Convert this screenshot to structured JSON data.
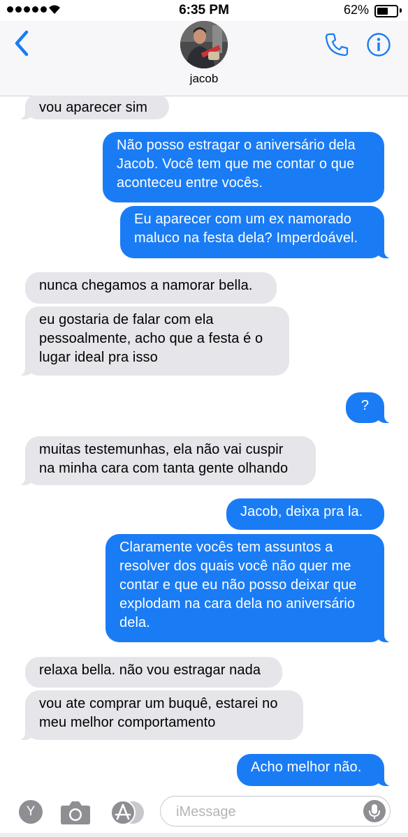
{
  "status_bar": {
    "time": "6:35 PM",
    "battery_percent": "62%",
    "battery_level": 0.62,
    "signal_bars": 5
  },
  "header": {
    "contact_name": "jacob",
    "back_icon": "chevron-left-icon",
    "call_icon": "phone-icon",
    "info_icon": "info-icon",
    "accent": "#1a7cf5"
  },
  "messages": [
    {
      "from": "them",
      "text": "vou aparecer sim"
    },
    {
      "from": "me",
      "text": "Não posso estragar o aniversário dela\nJacob. Você tem que me contar o que\naconteceu entre vocês."
    },
    {
      "from": "me",
      "text": "Eu aparecer com um ex namorado\nmaluco na festa dela? Imperdoável."
    },
    {
      "from": "them",
      "text": "nunca chegamos a namorar bella."
    },
    {
      "from": "them",
      "text": "eu gostaria de falar com ela\npessoalmente, acho que a festa é o\nlugar ideal pra isso"
    },
    {
      "from": "me",
      "text": "?"
    },
    {
      "from": "them",
      "text": "muitas testemunhas, ela não vai cuspir\nna minha cara com tanta gente olhando"
    },
    {
      "from": "me",
      "text": "Jacob, deixa pra la."
    },
    {
      "from": "me",
      "text": "Claramente vocês tem assuntos a\nresolver dos quais você não quer me\ncontar e que eu não posso deixar que\nexplodam na cara dela no aniversário\ndela."
    },
    {
      "from": "them",
      "text": "relaxa bella. não vou estragar nada"
    },
    {
      "from": "them",
      "text": "vou ate comprar um buquê, estarei no\nmeu melhor comportamento"
    },
    {
      "from": "me",
      "text": "Acho melhor não."
    }
  ],
  "input_bar": {
    "placeholder": "iMessage",
    "app_button_letter": "Y",
    "icons": [
      "y-app-icon",
      "camera-icon",
      "app-store-icon",
      "microphone-icon"
    ]
  },
  "colors": {
    "outgoing": "#1a7cf5",
    "incoming": "#e5e5ea"
  }
}
